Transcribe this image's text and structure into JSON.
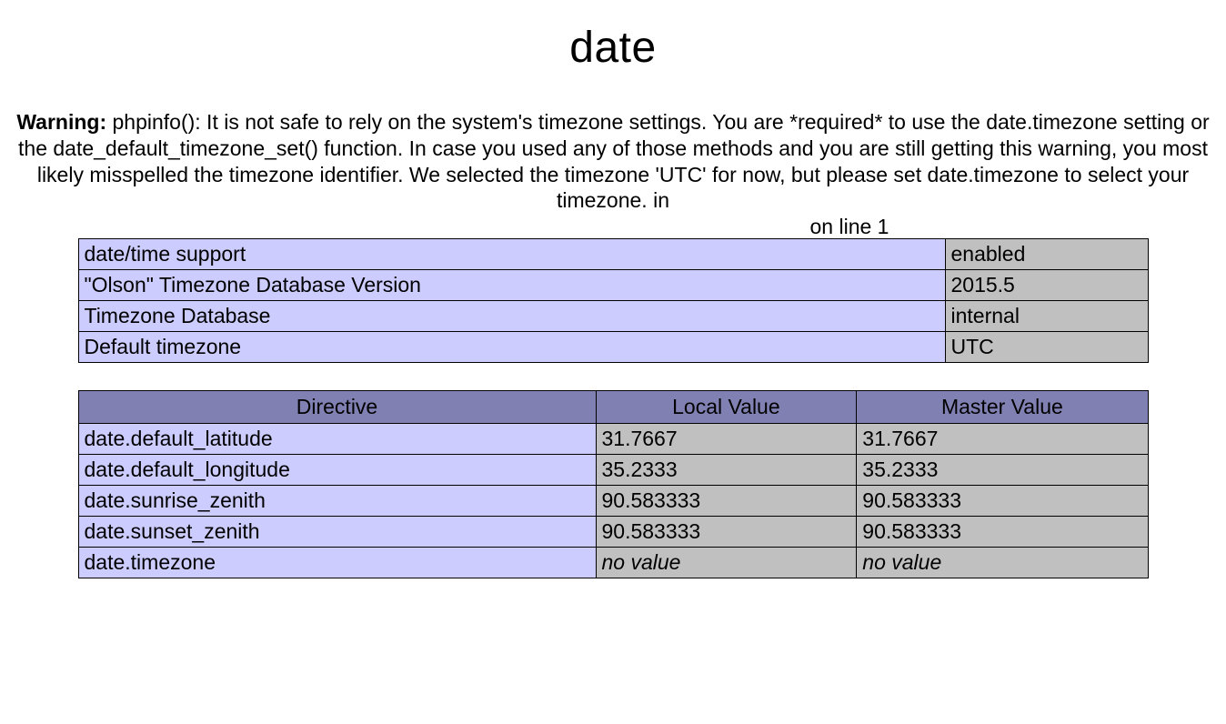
{
  "heading": "date",
  "warning": {
    "prefix": "Warning:",
    "body": " phpinfo(): It is not safe to rely on the system's timezone settings. You are *required* to use the date.timezone setting or the date_default_timezone_set() function. In case you used any of those methods and you are still getting this warning, you most likely misspelled the timezone identifier. We selected the timezone 'UTC' for now, but please set date.timezone to select your timezone. in ",
    "line_suffix": "on line 1"
  },
  "info_rows": [
    {
      "label": "date/time support",
      "value": "enabled"
    },
    {
      "label": "\"Olson\" Timezone Database Version",
      "value": "2015.5"
    },
    {
      "label": "Timezone Database",
      "value": "internal"
    },
    {
      "label": "Default timezone",
      "value": "UTC"
    }
  ],
  "directive_headers": {
    "col1": "Directive",
    "col2": "Local Value",
    "col3": "Master Value"
  },
  "directives": [
    {
      "name": "date.default_latitude",
      "local": "31.7667",
      "master": "31.7667",
      "local_novalue": false,
      "master_novalue": false
    },
    {
      "name": "date.default_longitude",
      "local": "35.2333",
      "master": "35.2333",
      "local_novalue": false,
      "master_novalue": false
    },
    {
      "name": "date.sunrise_zenith",
      "local": "90.583333",
      "master": "90.583333",
      "local_novalue": false,
      "master_novalue": false
    },
    {
      "name": "date.sunset_zenith",
      "local": "90.583333",
      "master": "90.583333",
      "local_novalue": false,
      "master_novalue": false
    },
    {
      "name": "date.timezone",
      "local": "no value",
      "master": "no value",
      "local_novalue": true,
      "master_novalue": true
    }
  ]
}
